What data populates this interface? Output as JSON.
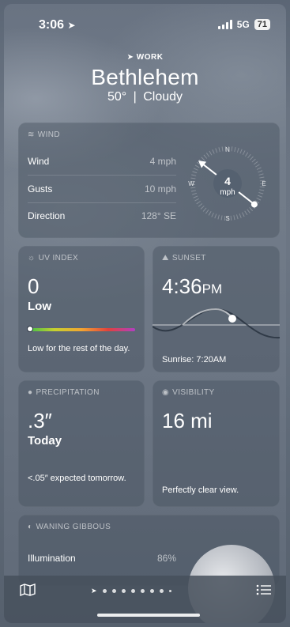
{
  "status": {
    "time": "3:06",
    "network": "5G",
    "battery": "71"
  },
  "header": {
    "location_label": "WORK",
    "city": "Bethlehem",
    "temp": "50°",
    "separator": "|",
    "condition": "Cloudy"
  },
  "wind": {
    "title": "WIND",
    "rows": [
      {
        "label": "Wind",
        "value": "4 mph"
      },
      {
        "label": "Gusts",
        "value": "10 mph"
      },
      {
        "label": "Direction",
        "value": "128° SE"
      }
    ],
    "compass": {
      "speed": "4",
      "unit": "mph",
      "n": "N",
      "e": "E",
      "s": "S",
      "w": "W",
      "direction_deg": 128
    }
  },
  "uv": {
    "title": "UV INDEX",
    "value": "0",
    "level": "Low",
    "desc": "Low for the rest of the day.",
    "scale_fraction": 0.0
  },
  "sunset": {
    "title": "SUNSET",
    "time": "4:36",
    "ampm": "PM",
    "sunrise": "Sunrise: 7:20AM"
  },
  "precipitation": {
    "title": "PRECIPITATION",
    "value": ".3″",
    "period": "Today",
    "desc": "<.05″ expected tomorrow."
  },
  "visibility": {
    "title": "VISIBILITY",
    "value": "16 mi",
    "desc": "Perfectly clear view."
  },
  "moon": {
    "title": "WANING GIBBOUS",
    "rows": [
      {
        "label": "Illumination",
        "value": "86%"
      }
    ]
  },
  "colors": {
    "accent": "#ffffff",
    "card_bg": "#465260",
    "muted_text": "#b9c0ca"
  }
}
